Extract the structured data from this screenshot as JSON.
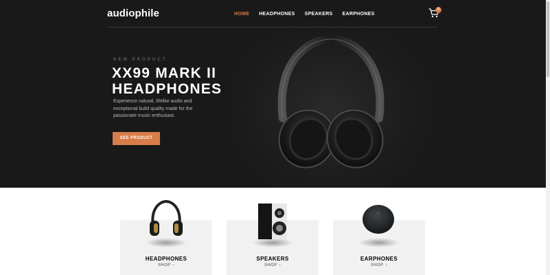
{
  "header": {
    "logo": "audiophile",
    "nav": [
      {
        "label": "HOME",
        "active": true
      },
      {
        "label": "HEADPHONES",
        "active": false
      },
      {
        "label": "SPEAKERS",
        "active": false
      },
      {
        "label": "EARPHONES",
        "active": false
      }
    ],
    "cart_icon": "cart-icon",
    "cart_count": "0"
  },
  "hero": {
    "overline": "NEW PRODUCT",
    "title_line1": "XX99 MARK II",
    "title_line2": "HEADPHONES",
    "description": "Experience natural, lifelike audio and exceptional build quality made for the passionate music enthusiast.",
    "cta_label": "SEE PRODUCT"
  },
  "categories": [
    {
      "name": "HEADPHONES",
      "shop_label": "SHOP",
      "chevron": "›"
    },
    {
      "name": "SPEAKERS",
      "shop_label": "SHOP",
      "chevron": "›"
    },
    {
      "name": "EARPHONES",
      "shop_label": "SHOP",
      "chevron": "›"
    }
  ],
  "colors": {
    "accent": "#d87d4a",
    "hero_bg": "#191919",
    "card_bg": "#f1f1f1"
  }
}
